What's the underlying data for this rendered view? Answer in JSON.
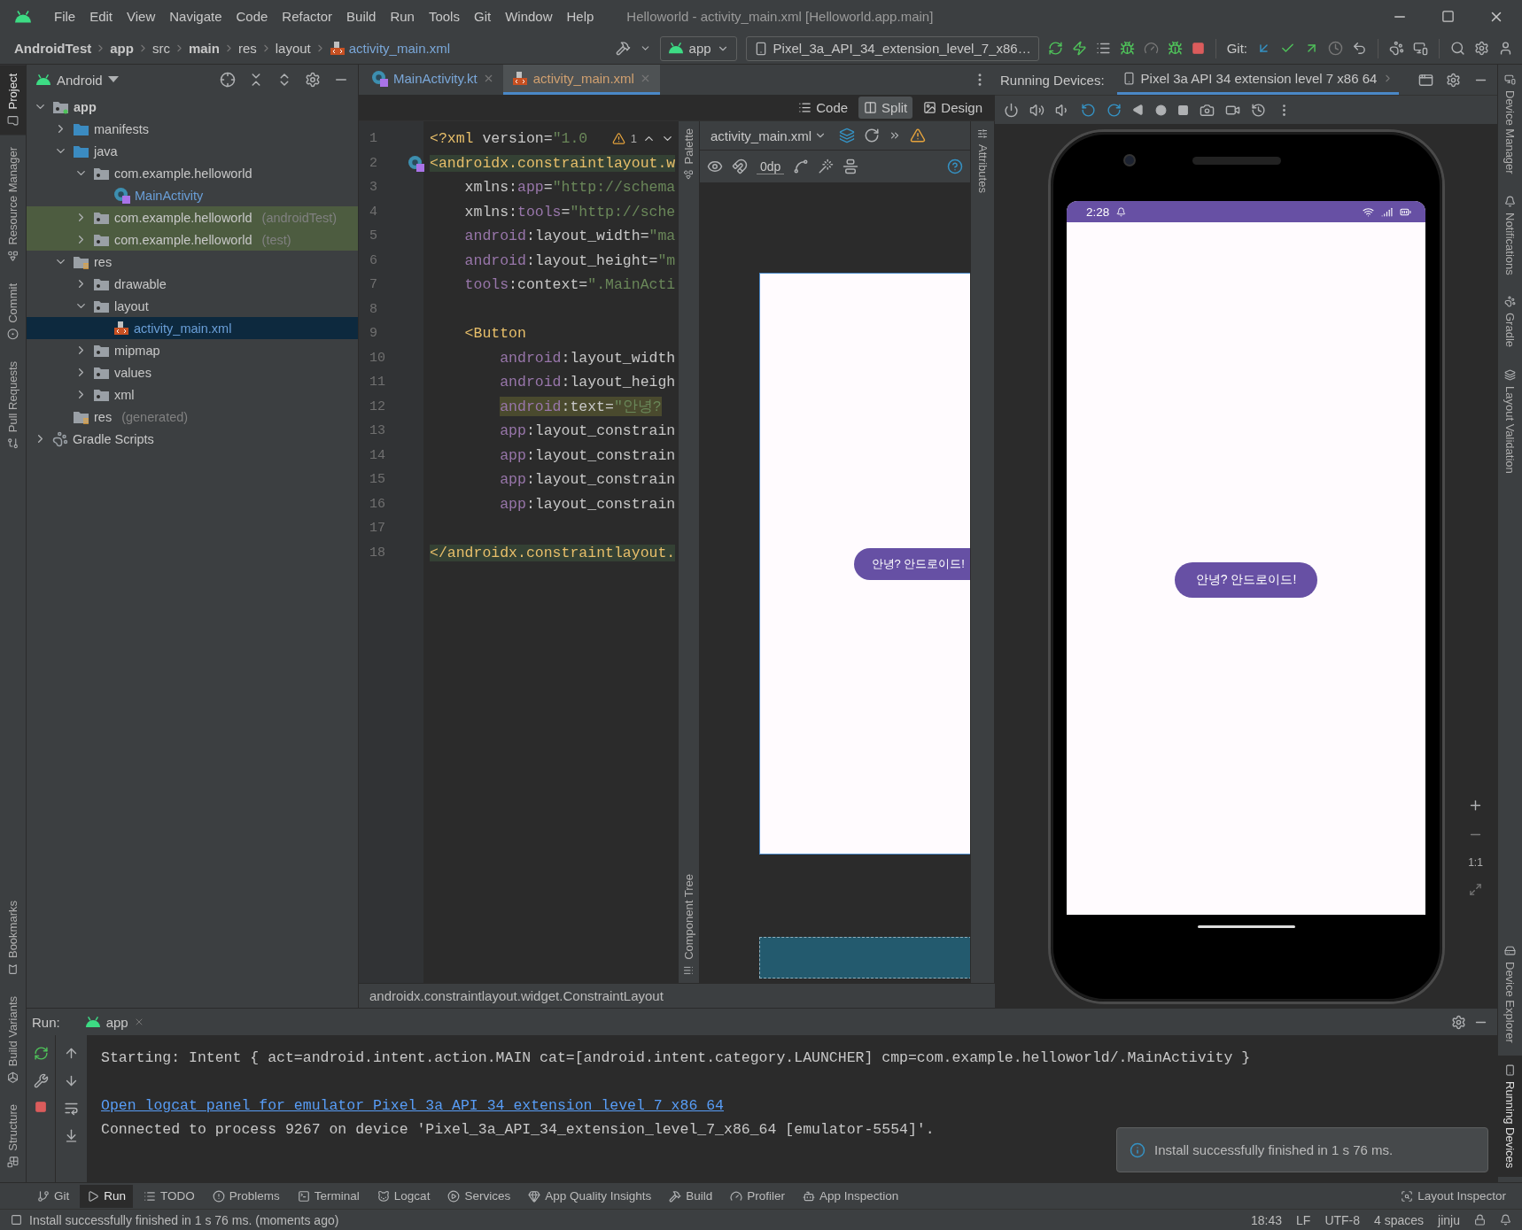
{
  "window": {
    "title": "Helloworld - activity_main.xml [Helloworld.app.main]"
  },
  "menu": [
    "File",
    "Edit",
    "View",
    "Navigate",
    "Code",
    "Refactor",
    "Build",
    "Run",
    "Tools",
    "Git",
    "Window",
    "Help"
  ],
  "breadcrumb": [
    {
      "label": "AndroidTest",
      "bold": true,
      "kind": "text"
    },
    {
      "label": "app",
      "bold": true,
      "kind": "text"
    },
    {
      "label": "src",
      "bold": false,
      "kind": "text"
    },
    {
      "label": "main",
      "bold": true,
      "kind": "text"
    },
    {
      "label": "res",
      "bold": false,
      "kind": "text"
    },
    {
      "label": "layout",
      "bold": false,
      "kind": "text"
    },
    {
      "label": "activity_main.xml",
      "bold": false,
      "kind": "file"
    }
  ],
  "toolbar": {
    "run_config": "app",
    "device": "Pixel_3a_API_34_extension_level_7_x86…",
    "git_label": "Git:"
  },
  "left_strip": {
    "top": [
      {
        "label": "Project",
        "selected": true
      },
      {
        "label": "Resource Manager",
        "selected": false
      },
      {
        "label": "Commit",
        "selected": false
      },
      {
        "label": "Pull Requests",
        "selected": false
      }
    ],
    "bottom": [
      {
        "label": "Bookmarks",
        "selected": false
      },
      {
        "label": "Build Variants",
        "selected": false
      },
      {
        "label": "Structure",
        "selected": false
      }
    ]
  },
  "project": {
    "view": "Android",
    "tree": [
      {
        "label": "app",
        "kind": "module",
        "expanded": true,
        "selected": false,
        "highlighted": false,
        "children": [
          {
            "label": "manifests",
            "kind": "folder",
            "expanded": false,
            "selected": false,
            "highlighted": false
          },
          {
            "label": "java",
            "kind": "folder",
            "expanded": true,
            "selected": false,
            "highlighted": false,
            "children": [
              {
                "label": "com.example.helloworld",
                "kind": "package",
                "expanded": true,
                "selected": false,
                "highlighted": false,
                "children": [
                  {
                    "label": "MainActivity",
                    "kind": "class",
                    "selected": false,
                    "highlighted": false
                  }
                ]
              },
              {
                "label": "com.example.helloworld",
                "suffix": "(androidTest)",
                "kind": "package",
                "expanded": false,
                "selected": false,
                "highlighted": true
              },
              {
                "label": "com.example.helloworld",
                "suffix": "(test)",
                "kind": "package",
                "expanded": false,
                "selected": false,
                "highlighted": true
              }
            ]
          },
          {
            "label": "res",
            "kind": "res",
            "expanded": true,
            "selected": false,
            "highlighted": false,
            "children": [
              {
                "label": "drawable",
                "kind": "package",
                "expanded": false,
                "selected": false,
                "highlighted": false
              },
              {
                "label": "layout",
                "kind": "package",
                "expanded": true,
                "selected": false,
                "highlighted": false,
                "children": [
                  {
                    "label": "activity_main.xml",
                    "kind": "xml",
                    "selected": true,
                    "highlighted": false
                  }
                ]
              },
              {
                "label": "mipmap",
                "kind": "package",
                "expanded": false,
                "selected": false,
                "highlighted": false
              },
              {
                "label": "values",
                "kind": "package",
                "expanded": false,
                "selected": false,
                "highlighted": false
              },
              {
                "label": "xml",
                "kind": "package",
                "expanded": false,
                "selected": false,
                "highlighted": false
              }
            ]
          },
          {
            "label": "res",
            "suffix": "(generated)",
            "kind": "res",
            "selected": false,
            "highlighted": false
          }
        ]
      },
      {
        "label": "Gradle Scripts",
        "kind": "gradle",
        "expanded": false,
        "selected": false,
        "highlighted": false
      }
    ]
  },
  "editor": {
    "tabs": [
      {
        "label": "MainActivity.kt",
        "kind": "kotlin",
        "selected": false
      },
      {
        "label": "activity_main.xml",
        "kind": "xml",
        "selected": true
      }
    ],
    "modes": [
      {
        "label": "Code",
        "selected": false
      },
      {
        "label": "Split",
        "selected": true
      },
      {
        "label": "Design",
        "selected": false
      }
    ],
    "inspection": {
      "count": "1"
    },
    "lines": [
      {
        "number": "1",
        "kind": "plain",
        "segments": [
          {
            "kind": "tag",
            "text": "<?xml"
          },
          {
            "kind": "attr",
            "text": " version="
          },
          {
            "kind": "string",
            "text": "\"1.0"
          }
        ]
      },
      {
        "number": "2",
        "kind": "match",
        "segments": [
          {
            "kind": "tag",
            "text": "<androidx.constraintlayout.w"
          }
        ]
      },
      {
        "number": "3",
        "kind": "plain",
        "segments": [
          {
            "kind": "attr",
            "text": "    xmlns:"
          },
          {
            "kind": "ns",
            "text": "app"
          },
          {
            "kind": "attr",
            "text": "="
          },
          {
            "kind": "string",
            "text": "\"http://schema"
          }
        ]
      },
      {
        "number": "4",
        "kind": "plain",
        "segments": [
          {
            "kind": "attr",
            "text": "    xmlns:"
          },
          {
            "kind": "ns",
            "text": "tools"
          },
          {
            "kind": "attr",
            "text": "="
          },
          {
            "kind": "string",
            "text": "\"http://sche"
          }
        ]
      },
      {
        "number": "5",
        "kind": "plain",
        "segments": [
          {
            "kind": "ns",
            "text": "    android"
          },
          {
            "kind": "attr",
            "text": ":layout_width="
          },
          {
            "kind": "string",
            "text": "\"ma"
          }
        ]
      },
      {
        "number": "6",
        "kind": "plain",
        "segments": [
          {
            "kind": "ns",
            "text": "    android"
          },
          {
            "kind": "attr",
            "text": ":layout_height="
          },
          {
            "kind": "string",
            "text": "\"m"
          }
        ]
      },
      {
        "number": "7",
        "kind": "plain",
        "segments": [
          {
            "kind": "ns",
            "text": "    tools"
          },
          {
            "kind": "attr",
            "text": ":context="
          },
          {
            "kind": "string",
            "text": "\".MainActi"
          }
        ]
      },
      {
        "number": "8"
      },
      {
        "number": "9",
        "kind": "plain",
        "segments": [
          {
            "kind": "tag",
            "text": "    <Button"
          }
        ]
      },
      {
        "number": "10",
        "kind": "plain",
        "segments": [
          {
            "kind": "ns",
            "text": "        android"
          },
          {
            "kind": "attr",
            "text": ":layout_width"
          }
        ]
      },
      {
        "number": "11",
        "kind": "plain",
        "segments": [
          {
            "kind": "ns",
            "text": "        android"
          },
          {
            "kind": "attr",
            "text": ":layout_heigh"
          }
        ]
      },
      {
        "number": "12",
        "kind": "warning",
        "segments": [
          {
            "kind": "ns",
            "text": "        android"
          },
          {
            "kind": "attr",
            "text": ":text="
          },
          {
            "kind": "string",
            "text": "\"안녕?"
          }
        ]
      },
      {
        "number": "13",
        "kind": "plain",
        "segments": [
          {
            "kind": "ns",
            "text": "        app"
          },
          {
            "kind": "attr",
            "text": ":layout_constrain"
          }
        ]
      },
      {
        "number": "14",
        "kind": "plain",
        "segments": [
          {
            "kind": "ns",
            "text": "        app"
          },
          {
            "kind": "attr",
            "text": ":layout_constrain"
          }
        ]
      },
      {
        "number": "15",
        "kind": "plain",
        "segments": [
          {
            "kind": "ns",
            "text": "        app"
          },
          {
            "kind": "attr",
            "text": ":layout_constrain"
          }
        ]
      },
      {
        "number": "16",
        "kind": "plain",
        "segments": [
          {
            "kind": "ns",
            "text": "        app"
          },
          {
            "kind": "attr",
            "text": ":layout_constrain"
          }
        ]
      },
      {
        "number": "17"
      },
      {
        "number": "18",
        "kind": "match",
        "segments": [
          {
            "kind": "tag",
            "text": "</androidx.constraintlayout."
          }
        ]
      }
    ],
    "status": "androidx.constraintlayout.widget.ConstraintLayout"
  },
  "design": {
    "file": "activity_main.xml",
    "margin": "0dp",
    "palette_label": "Palette",
    "tree_label": "Component Tree",
    "attributes_label": "Attributes",
    "button_text": "안녕? 안드로이드!"
  },
  "devices": {
    "label": "Running Devices:",
    "tab": "Pixel 3a API 34 extension level 7 x86 64",
    "phone": {
      "time": "2:28",
      "button_text": "안녕? 안드로이드!"
    },
    "zoom_label": "1:1"
  },
  "right_strip": {
    "top": [
      {
        "label": "Device Manager",
        "selected": false
      },
      {
        "label": "Notifications",
        "selected": false
      },
      {
        "label": "Gradle",
        "selected": false
      },
      {
        "label": "Layout Validation",
        "selected": false
      }
    ],
    "bottom": [
      {
        "label": "Device Explorer",
        "selected": false
      },
      {
        "label": "Running Devices",
        "selected": true
      }
    ]
  },
  "run": {
    "label": "Run:",
    "tab": "app",
    "console": [
      {
        "kind": "text",
        "text": "Starting: Intent { act=android.intent.action.MAIN cat=[android.intent.category.LAUNCHER] cmp=com.example.helloworld/.MainActivity }"
      },
      {
        "kind": "link",
        "text": "Open logcat panel for emulator Pixel 3a API 34 extension level 7 x86 64"
      },
      {
        "kind": "text",
        "text": "Connected to process 9267 on device 'Pixel_3a_API_34_extension_level_7_x86_64 [emulator-5554]'."
      }
    ],
    "notification": "Install successfully finished in 1 s 76 ms."
  },
  "tool_windows": [
    {
      "label": "Git",
      "selected": false
    },
    {
      "label": "Run",
      "selected": true
    },
    {
      "label": "TODO",
      "selected": false
    },
    {
      "label": "Problems",
      "selected": false
    },
    {
      "label": "Terminal",
      "selected": false
    },
    {
      "label": "Logcat",
      "selected": false
    },
    {
      "label": "Services",
      "selected": false
    },
    {
      "label": "App Quality Insights",
      "selected": false
    },
    {
      "label": "Build",
      "selected": false
    },
    {
      "label": "Profiler",
      "selected": false
    },
    {
      "label": "App Inspection",
      "selected": false
    }
  ],
  "tool_windows_right": [
    "Layout Inspector"
  ],
  "status_bar": {
    "message": "Install successfully finished in 1 s 76 ms. (moments ago)",
    "items": [
      "18:43",
      "LF",
      "UTF-8",
      "4 spaces",
      "jinju"
    ]
  }
}
